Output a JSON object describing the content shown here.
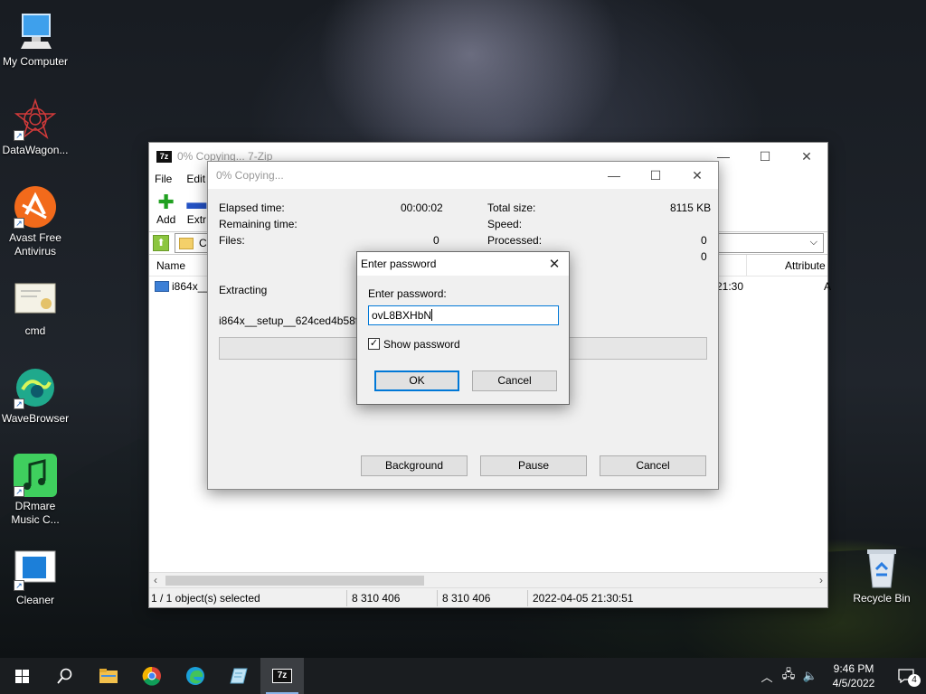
{
  "desktop": {
    "icons": [
      {
        "label": "My Computer",
        "icon": "computer-icon"
      },
      {
        "label": "DataWagon...",
        "icon": "datawagon-icon"
      },
      {
        "label": "Avast Free Antivirus",
        "icon": "avast-icon"
      },
      {
        "label": "cmd",
        "icon": "certificate-icon"
      },
      {
        "label": "WaveBrowser",
        "icon": "wavebrowser-icon"
      },
      {
        "label": "DRmare Music C...",
        "icon": "drmare-icon"
      },
      {
        "label": "Cleaner",
        "icon": "cleaner-icon"
      },
      {
        "label": "Recycle Bin",
        "icon": "recycle-bin-icon"
      }
    ]
  },
  "main_window": {
    "title": "0% Copying... 7-Zip",
    "menu": [
      "File",
      "Edit"
    ],
    "toolbar": {
      "add": "Add",
      "extract": "Extr"
    },
    "address": "C",
    "columns": {
      "name": "Name",
      "attributes": "Attribute"
    },
    "rows": [
      {
        "name": "i864x__s",
        "modified_time": "21:30",
        "attr": "A"
      }
    ],
    "status": {
      "selected": "1 / 1 object(s) selected",
      "size": "8 310 406",
      "packed": "8 310 406",
      "modified": "2022-04-05 21:30:51"
    }
  },
  "progress_dialog": {
    "title": "0% Copying...",
    "elapsed_label": "Elapsed time:",
    "elapsed_value": "00:00:02",
    "remaining_label": "Remaining time:",
    "files_label": "Files:",
    "files_value": "0",
    "total_label": "Total size:",
    "total_value": "8115 KB",
    "speed_label": "Speed:",
    "processed_label": "Processed:",
    "processed_value": "0",
    "extra_value": "0",
    "action": "Extracting",
    "filename": "i864x__setup__624ced4b58f74.",
    "progress": 0,
    "buttons": {
      "background": "Background",
      "pause": "Pause",
      "cancel": "Cancel"
    }
  },
  "password_dialog": {
    "title": "Enter password",
    "prompt": "Enter password:",
    "value": "ovL8BXHbN",
    "show_password_label": "Show password",
    "show_password_checked": true,
    "ok": "OK",
    "cancel": "Cancel"
  },
  "taskbar": {
    "time": "9:46 PM",
    "date": "4/5/2022",
    "notification_count": "4"
  }
}
